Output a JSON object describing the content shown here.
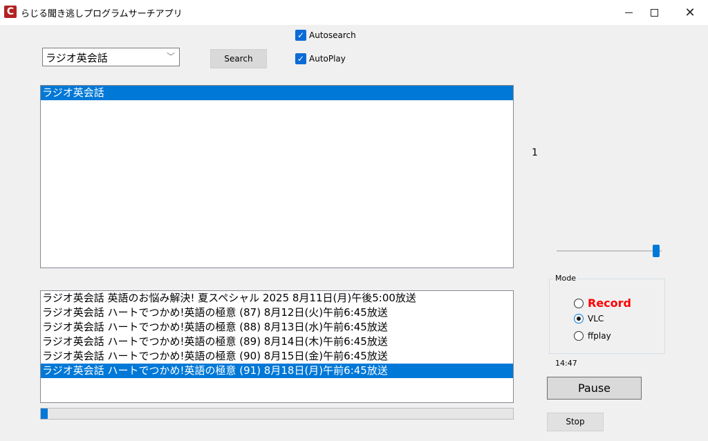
{
  "window": {
    "title": "らじる聞き逃しプログラムサーチアプリ",
    "app_icon_letter": "C",
    "close_glyph": "✕"
  },
  "search": {
    "combo_value": "ラジオ英会話",
    "combo_arrow": "﹀",
    "button_label": "Search"
  },
  "options": {
    "autosearch_label": "Autosearch",
    "autosearch_checked": true,
    "autoplay_label": "AutoPlay",
    "autoplay_checked": true,
    "check_glyph": "✓"
  },
  "program_list": {
    "items": [
      "ラジオ英会話"
    ],
    "selected_index": 0
  },
  "episode_list": {
    "items": [
      "ラジオ英会話 英語のお悩み解決! 夏スペシャル 2025 8月11日(月)午後5:00放送",
      "ラジオ英会話 ハートでつかめ!英語の極意 (87) 8月12日(火)午前6:45放送",
      "ラジオ英会話 ハートでつかめ!英語の極意 (88) 8月13日(水)午前6:45放送",
      "ラジオ英会話 ハートでつかめ!英語の極意 (89) 8月14日(木)午前6:45放送",
      "ラジオ英会話 ハートでつかめ!英語の極意 (90) 8月15日(金)午前6:45放送",
      "ラジオ英会話 ハートでつかめ!英語の極意 (91) 8月18日(月)午前6:45放送"
    ],
    "selected_index": 5
  },
  "counter": "1",
  "volume": {
    "level": 0.95
  },
  "mode": {
    "legend": "Mode",
    "options": [
      "Record",
      "VLC",
      "ffplay"
    ],
    "selected": "VLC",
    "record_color": "#ff0000"
  },
  "playback": {
    "time": "14:47",
    "pause_label": "Pause",
    "stop_label": "Stop",
    "progress": 0.015
  },
  "colors": {
    "accent": "#0078d7",
    "checkbox": "#0b6bd6"
  }
}
